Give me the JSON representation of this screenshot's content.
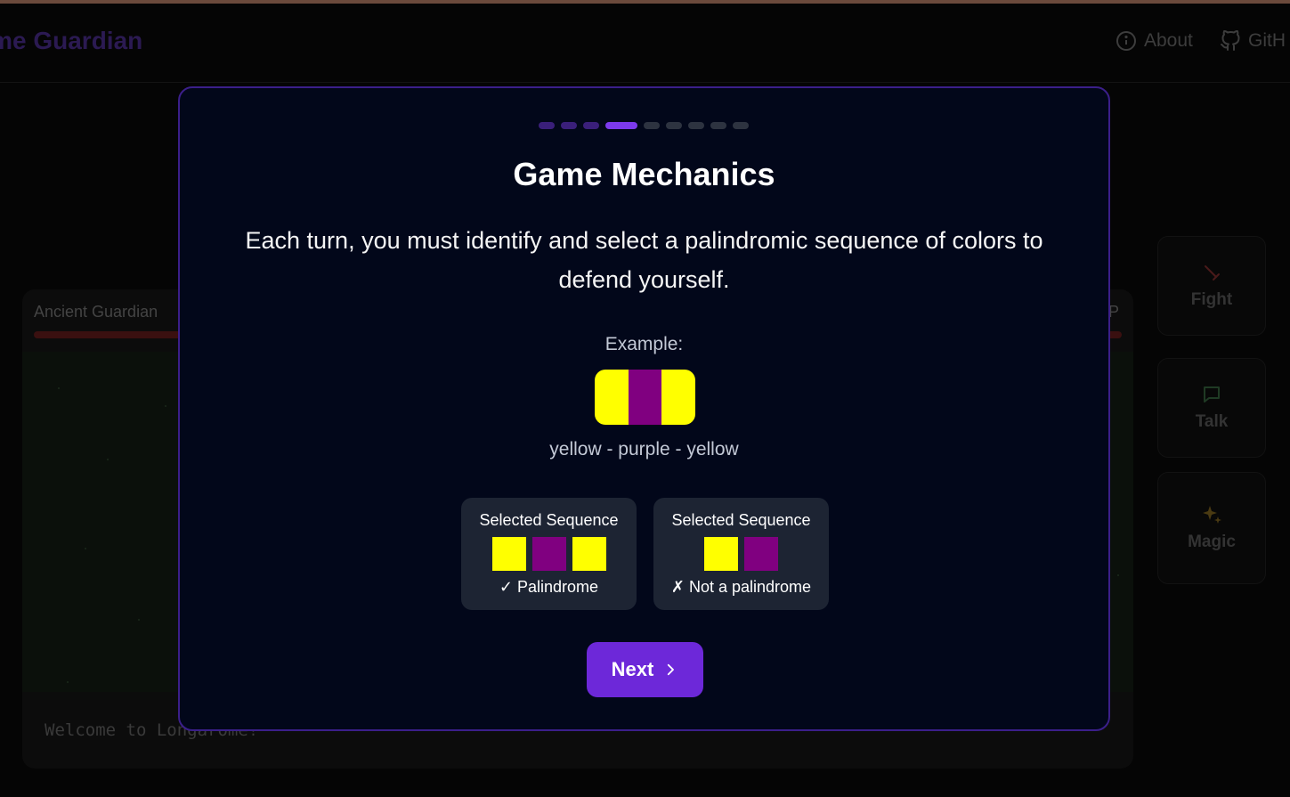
{
  "header": {
    "brand": "ome Guardian",
    "about_label": "About",
    "github_label": "GitH"
  },
  "battle": {
    "enemy_name": "Ancient Guardian",
    "enemy_hp_label": "P",
    "log_text": "Welcome to Longarome!"
  },
  "actions": [
    {
      "label": "Fight",
      "icon": "sword-icon"
    },
    {
      "label": "Talk",
      "icon": "chat-bubble-icon"
    },
    {
      "label": "Magic",
      "icon": "sparkles-icon"
    }
  ],
  "modal": {
    "progress": {
      "total_steps": 9,
      "current_step": 4
    },
    "title": "Game Mechanics",
    "body": "Each turn, you must identify and select a palindromic sequence of colors to defend yourself.",
    "example_label": "Example:",
    "example_colors": [
      "#ffff00",
      "#800080",
      "#ffff00"
    ],
    "example_caption": "yellow - purple - yellow",
    "cards": [
      {
        "title": "Selected Sequence",
        "colors": [
          "#ffff00",
          "#800080",
          "#ffff00"
        ],
        "result": "✓ Palindrome"
      },
      {
        "title": "Selected Sequence",
        "colors": [
          "#ffff00",
          "#800080"
        ],
        "result": "✗ Not a palindrome"
      }
    ],
    "next_label": "Next"
  },
  "colors": {
    "accent": "#6d28d9",
    "modal_border": "#3b1f8a",
    "yellow": "#ffff00",
    "purple": "#800080"
  }
}
